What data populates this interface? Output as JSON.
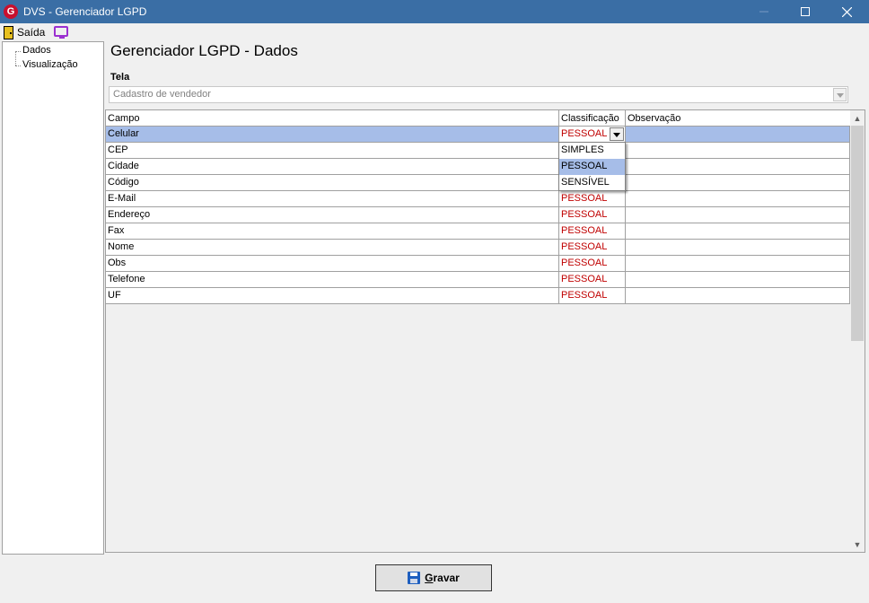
{
  "window": {
    "title": "DVS - Gerenciador LGPD",
    "app_icon": "app-logo-icon"
  },
  "toolbar": {
    "exit_label": "Saída"
  },
  "sidebar": {
    "items": [
      {
        "label": "Dados"
      },
      {
        "label": "Visualização"
      }
    ]
  },
  "main": {
    "title": "Gerenciador LGPD - Dados",
    "screen_label": "Tela",
    "screen_value": "Cadastro de vendedor"
  },
  "grid": {
    "columns": [
      "Campo",
      "Classificação",
      "Observação"
    ],
    "rows": [
      {
        "campo": "Celular",
        "classificacao": "PESSOAL",
        "observacao": ""
      },
      {
        "campo": "CEP",
        "classificacao": "",
        "observacao": ""
      },
      {
        "campo": "Cidade",
        "classificacao": "",
        "observacao": ""
      },
      {
        "campo": "Código",
        "classificacao": "",
        "observacao": ""
      },
      {
        "campo": "E-Mail",
        "classificacao": "PESSOAL",
        "observacao": ""
      },
      {
        "campo": "Endereço",
        "classificacao": "PESSOAL",
        "observacao": ""
      },
      {
        "campo": "Fax",
        "classificacao": "PESSOAL",
        "observacao": ""
      },
      {
        "campo": "Nome",
        "classificacao": "PESSOAL",
        "observacao": ""
      },
      {
        "campo": "Obs",
        "classificacao": "PESSOAL",
        "observacao": ""
      },
      {
        "campo": "Telefone",
        "classificacao": "PESSOAL",
        "observacao": ""
      },
      {
        "campo": "UF",
        "classificacao": "PESSOAL",
        "observacao": ""
      }
    ],
    "dropdown_options": [
      "SIMPLES",
      "PESSOAL",
      "SENSÍVEL"
    ],
    "dropdown_selected": "PESSOAL"
  },
  "footer": {
    "save_label": "Gravar"
  },
  "colors": {
    "titlebar": "#3a6ea5",
    "selection": "#a6bde8",
    "classification_text": "#c00000"
  }
}
